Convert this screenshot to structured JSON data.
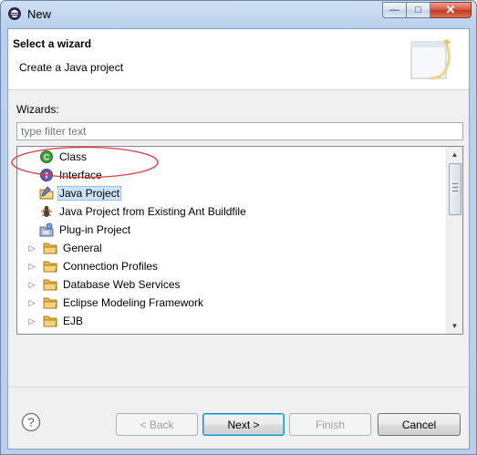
{
  "window": {
    "title": "New"
  },
  "banner": {
    "title": "Select a wizard",
    "description": "Create a Java project"
  },
  "wizards": {
    "label": "Wizards:",
    "filter_placeholder": "type filter text",
    "items": [
      {
        "label": "Class",
        "icon": "java-class-icon",
        "expandable": false,
        "selected": false
      },
      {
        "label": "Interface",
        "icon": "java-interface-icon",
        "expandable": false,
        "selected": false
      },
      {
        "label": "Java Project",
        "icon": "java-project-icon",
        "expandable": false,
        "selected": true
      },
      {
        "label": "Java Project from Existing Ant Buildfile",
        "icon": "ant-project-icon",
        "expandable": false,
        "selected": false
      },
      {
        "label": "Plug-in Project",
        "icon": "plugin-project-icon",
        "expandable": false,
        "selected": false
      },
      {
        "label": "General",
        "icon": "folder-icon",
        "expandable": true,
        "selected": false
      },
      {
        "label": "Connection Profiles",
        "icon": "folder-icon",
        "expandable": true,
        "selected": false
      },
      {
        "label": "Database Web Services",
        "icon": "folder-icon",
        "expandable": true,
        "selected": false
      },
      {
        "label": "Eclipse Modeling Framework",
        "icon": "folder-icon",
        "expandable": true,
        "selected": false
      },
      {
        "label": "EJB",
        "icon": "folder-icon",
        "expandable": true,
        "selected": false
      }
    ]
  },
  "buttons": {
    "back": "< Back",
    "next": "Next >",
    "finish": "Finish",
    "cancel": "Cancel"
  },
  "colors": {
    "selection": "#cde3f7",
    "highlight_ellipse": "#e0393e",
    "folder": "#e8b84a"
  }
}
